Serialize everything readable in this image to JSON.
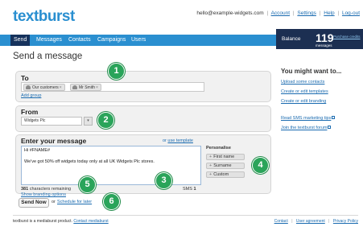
{
  "header": {
    "logo": "textburst",
    "email": "hello@example-widgets.com",
    "links": [
      "Account",
      "Settings",
      "Help",
      "Log-out"
    ]
  },
  "nav": {
    "tabs": [
      "Send",
      "Messages",
      "Contacts",
      "Campaigns",
      "Users"
    ],
    "active": "Send"
  },
  "balance": {
    "label": "Balance",
    "value": "119",
    "unit": "messages",
    "purchase_link": "Purchase credits"
  },
  "page": {
    "title": "Send a message"
  },
  "to_section": {
    "title": "To",
    "recipients": [
      {
        "label": "Our customers",
        "remove": "×"
      },
      {
        "label": "Mr Smith",
        "remove": "×"
      }
    ],
    "add_group": "Add group"
  },
  "from_section": {
    "title": "From",
    "selected": "Widgets Plc",
    "dropdown_glyph": "▾"
  },
  "message_section": {
    "title": "Enter your message",
    "or_text": "or",
    "use_template": "use template",
    "line1": "Hi #FNAME#",
    "line2": "We've got 50% off widgets today only at all UK Widgets Plc stores.",
    "chars_remaining_count": "381",
    "chars_remaining_text": "characters remaining",
    "show_branding": "Show branding options",
    "sms_label": "SMS",
    "sms_count": "1",
    "personalise_label": "Personalise",
    "personalise_buttons": [
      "First name",
      "Surname",
      "Custom"
    ]
  },
  "actions": {
    "send_now": "Send Now",
    "or_text": "or",
    "schedule": "Schedule for later"
  },
  "sidebar": {
    "title": "You might want to...",
    "links": [
      "Upload some contacts",
      "Create or edit templates",
      "Create or edit branding",
      "Read SMS marketing tips",
      "Join the textburst forum"
    ]
  },
  "badges": [
    "1",
    "2",
    "3",
    "4",
    "5",
    "6"
  ],
  "footer": {
    "left_text": "textburst is a mediaburst product.",
    "left_link": "Contact mediaburst",
    "links": [
      "Contact",
      "User agreement",
      "Privacy Policy"
    ]
  },
  "colors": {
    "brand_blue": "#2a8fd0",
    "nav_active": "#16325c",
    "balance_bg": "#1c2f52",
    "badge_green": "#2aa45a",
    "link": "#1a6bb0"
  },
  "icons": {
    "chip_icon": "contacts-icon",
    "sidebar_external": "external-link-icon",
    "personalise_plus": "plus-icon"
  }
}
